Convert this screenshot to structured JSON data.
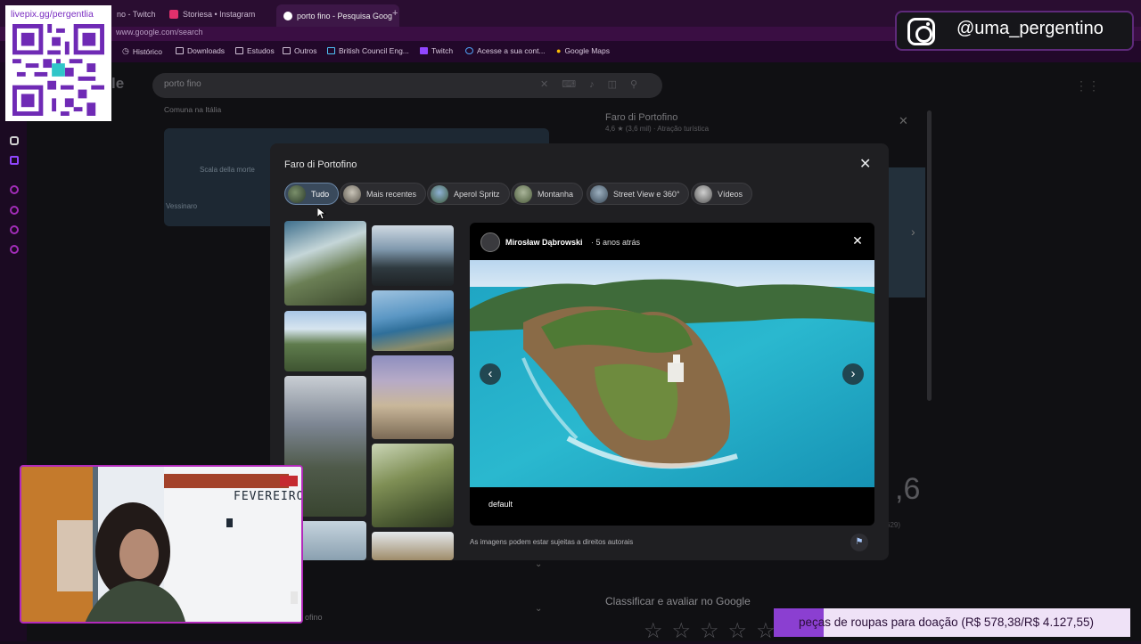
{
  "browser": {
    "tabs": [
      {
        "label": "no - Twitch",
        "icon_color": "#9146ff"
      },
      {
        "label": "Storiesa • Instagram",
        "icon_color": "#e1306c"
      },
      {
        "label": "porto fino - Pesquisa Goog",
        "icon_color": "#ffffff",
        "active": true
      }
    ],
    "url": "www.google.com/search",
    "bookmarks": [
      "Histórico",
      "Downloads",
      "Estudos",
      "Outros",
      "British Council Eng...",
      "Twitch",
      "Acesse a sua cont...",
      "Google Maps"
    ]
  },
  "google": {
    "logo_fragment": "le",
    "search_query": "porto fino",
    "subtitle": "Comuna na Itália",
    "map_labels": [
      "Scala della morte",
      "Vessinaro"
    ],
    "knowledge_panel": {
      "title": "Faro di Portofino",
      "rating_line": "4,6 ★ (3,6 mil) · Atração turística",
      "big_rating": ",6",
      "review_count": "629)"
    },
    "rate_title": "Classificar e avaliar no Google",
    "footer_fragment": "ofino"
  },
  "dialog": {
    "title": "Faro di Portofino",
    "chips": [
      {
        "label": "Tudo",
        "selected": true
      },
      {
        "label": "Mais recentes"
      },
      {
        "label": "Aperol Spritz"
      },
      {
        "label": "Montanha"
      },
      {
        "label": "Street View e 360°"
      },
      {
        "label": "Vídeos"
      }
    ],
    "viewer": {
      "author": "Mirosław Dąbrowski",
      "posted": "· 5 anos atrás",
      "caption": "default",
      "rights_notice": "As imagens podem estar sujeitas a direitos autorais"
    }
  },
  "overlays": {
    "qr_label": "livepix.gg/pergentlia",
    "instagram_handle": "@uma_pergentino",
    "webcam_sign": "FEVEREIRO",
    "donation_text": "peças de roupas para doação (R$ 578,38/R$ 4.127,55)",
    "donation_progress": 0.14
  }
}
